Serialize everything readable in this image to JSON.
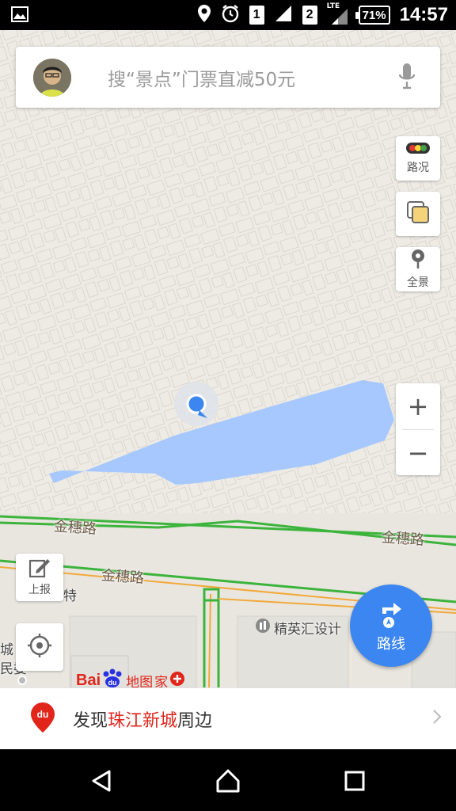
{
  "status_bar": {
    "icons": [
      "image-icon",
      "location-icon",
      "alarm-icon",
      "sim1-icon",
      "signal-icon",
      "sim2-icon",
      "lte-signal-icon",
      "battery-icon"
    ],
    "sim1": "1",
    "sim2": "2",
    "lte": "LTE",
    "battery_percent": "71%",
    "time": "14:57"
  },
  "search": {
    "placeholder": "搜“景点”门票直减50元"
  },
  "side_controls": {
    "traffic_label": "路况",
    "layers_label": "",
    "panorama_label": "全景",
    "zoom_in": "+",
    "zoom_out": "−"
  },
  "map": {
    "road_labels": [
      "金穗路",
      "金穗路",
      "金穗路"
    ],
    "poi_labels": [
      "精英汇设计",
      "特",
      "城",
      "民委"
    ],
    "baidu_logo_text": "Bai",
    "baidu_map_word": "地图",
    "baidu_home_word": "家",
    "colors": {
      "background": "#eeebe5",
      "water": "#a6c8ff",
      "road_green": "#3cb43c",
      "road_orange": "#f2a93b",
      "location_dot": "#3b86f0"
    }
  },
  "report_button": {
    "label": "上报"
  },
  "route_button": {
    "label": "路线"
  },
  "banner": {
    "prefix": "发现",
    "highlight": "珠江新城",
    "suffix": "周边",
    "pin_text": "du"
  },
  "nav_bar": {
    "icons": [
      "back-icon",
      "home-icon",
      "recents-icon"
    ]
  }
}
